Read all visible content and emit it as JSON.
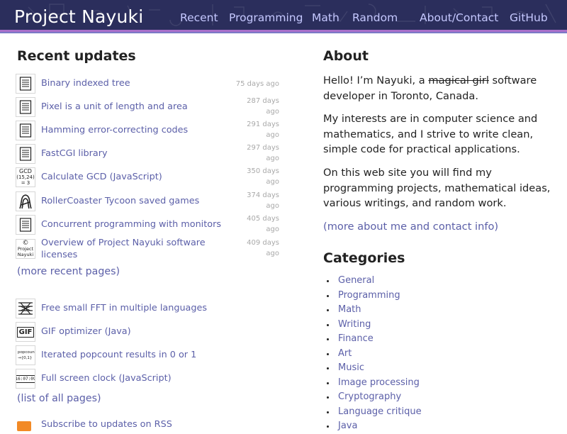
{
  "header": {
    "site_title": "Project Nayuki",
    "nav": [
      "Recent",
      "Programming",
      "Math",
      "Random",
      "About/Contact",
      "GitHub"
    ],
    "colors": {
      "bar": "#2b2e5c",
      "stripe_top": "#a96fc9",
      "stripe_bottom": "#7b79c7",
      "nav": "#c5c8ff"
    }
  },
  "recent": {
    "heading": "Recent updates",
    "items": [
      {
        "icon": "document-icon",
        "title": "Binary indexed tree",
        "date": "75 days ago"
      },
      {
        "icon": "document-icon",
        "title": "Pixel is a unit of length and area",
        "date": "287 days ago"
      },
      {
        "icon": "document-icon",
        "title": "Hamming error-correcting codes",
        "date": "291 days ago"
      },
      {
        "icon": "document-icon",
        "title": "FastCGI library",
        "date": "297 days ago"
      },
      {
        "icon": "gcd-icon",
        "icon_text": [
          "GCD",
          "(15,24)",
          "= 3"
        ],
        "title": "Calculate GCD (JavaScript)",
        "date": "350 days ago"
      },
      {
        "icon": "rollercoaster-loop-icon",
        "title": "RollerCoaster Tycoon saved games",
        "date": "374 days ago"
      },
      {
        "icon": "document-icon",
        "title": "Concurrent programming with monitors",
        "date": "405 days ago"
      },
      {
        "icon": "copyright-icon",
        "icon_text": [
          "©",
          "Project",
          "Nayuki"
        ],
        "title": "Overview of Project Nayuki software licenses",
        "date": "409 days ago"
      }
    ],
    "more_link": "(more recent pages)"
  },
  "featured": {
    "items": [
      {
        "icon": "fft-butterfly-icon",
        "title": "Free small FFT in multiple languages"
      },
      {
        "icon": "gif-icon",
        "icon_text": "GIF",
        "title": "GIF optimizer (Java)"
      },
      {
        "icon": "popcount-icon",
        "icon_text": [
          "popcount",
          "→{0,1}"
        ],
        "title": "Iterated popcount results in 0 or 1"
      },
      {
        "icon": "clock-icon",
        "icon_text": "16:07:09",
        "title": "Full screen clock (JavaScript)"
      }
    ],
    "all_pages_link": "(list of all pages)",
    "rss_text": "Subscribe to updates on RSS"
  },
  "about": {
    "heading": "About",
    "para1_before": "Hello! I’m Nayuki, a ",
    "para1_struck": "magical girl",
    "para1_after": " software developer in Toronto, Canada.",
    "para2": "My interests are in computer science and mathematics, and I strive to write clean, simple code for practical applications.",
    "para3": "On this web site you will find my programming projects, mathematical ideas, various writings, and random work.",
    "more_link": "(more about me and contact info)"
  },
  "categories": {
    "heading": "Categories",
    "items": [
      "General",
      "Programming",
      "Math",
      "Writing",
      "Finance",
      "Art",
      "Music",
      "Image processing",
      "Cryptography",
      "Language critique",
      "Java"
    ]
  },
  "colors": {
    "link": "#5b5fa8",
    "text": "#222222",
    "date": "#a9a9a9"
  }
}
